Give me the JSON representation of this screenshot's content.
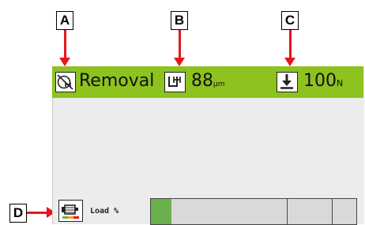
{
  "callouts": {
    "a": "A",
    "b": "B",
    "c": "C",
    "d": "D"
  },
  "status_bar": {
    "color": "#8dc21f",
    "mode_icon": "removal-mode-icon",
    "mode_label": "Removal",
    "depth_icon": "depth-icon",
    "depth_value": "88",
    "depth_unit": "µm",
    "force_icon": "force-down-icon",
    "force_value": "100",
    "force_unit": "N"
  },
  "load": {
    "icon": "motor-icon",
    "label": "Load %",
    "level_fraction": 0.1,
    "fill_color": "#6ab04c"
  }
}
